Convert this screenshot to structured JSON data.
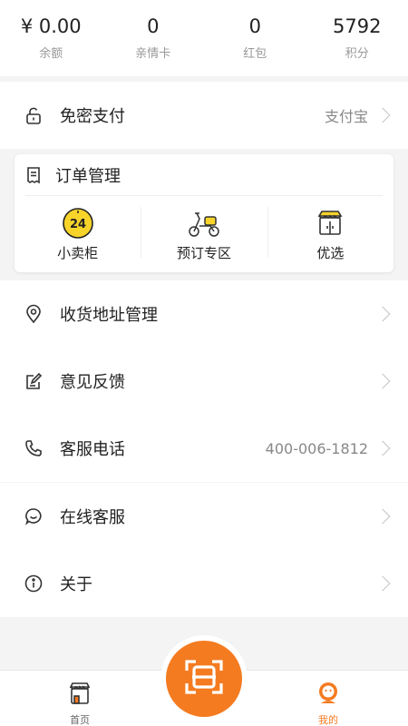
{
  "stats": [
    {
      "value": "¥ 0.00",
      "label": "余额"
    },
    {
      "value": "0",
      "label": "亲情卡"
    },
    {
      "value": "0",
      "label": "红包"
    },
    {
      "value": "5792",
      "label": "积分"
    }
  ],
  "password_free_pay": {
    "label": "免密支付",
    "value": "支付宝",
    "icon": "unlock-icon"
  },
  "order_management": {
    "label": "订单管理",
    "icon": "receipt-icon",
    "items": [
      {
        "label": "小卖柜",
        "icon": "clock-24-icon"
      },
      {
        "label": "预订专区",
        "icon": "scooter-icon"
      },
      {
        "label": "优选",
        "icon": "shop-icon"
      }
    ]
  },
  "menu": [
    {
      "label": "收货地址管理",
      "value": "",
      "icon": "location-pin-icon"
    },
    {
      "label": "意见反馈",
      "value": "",
      "icon": "feedback-edit-icon"
    },
    {
      "label": "客服电话",
      "value": "400-006-1812",
      "icon": "phone-icon"
    },
    {
      "label": "在线客服",
      "value": "",
      "icon": "chat-bubble-icon"
    },
    {
      "label": "关于",
      "value": "",
      "icon": "info-icon"
    }
  ],
  "tabbar": {
    "home_label": "首页",
    "mine_label": "我的",
    "scan_icon": "scan-icon"
  },
  "colors": {
    "accent": "#f47b20",
    "badge_yellow": "#f8d42a",
    "text": "#222222",
    "muted": "#999999"
  }
}
